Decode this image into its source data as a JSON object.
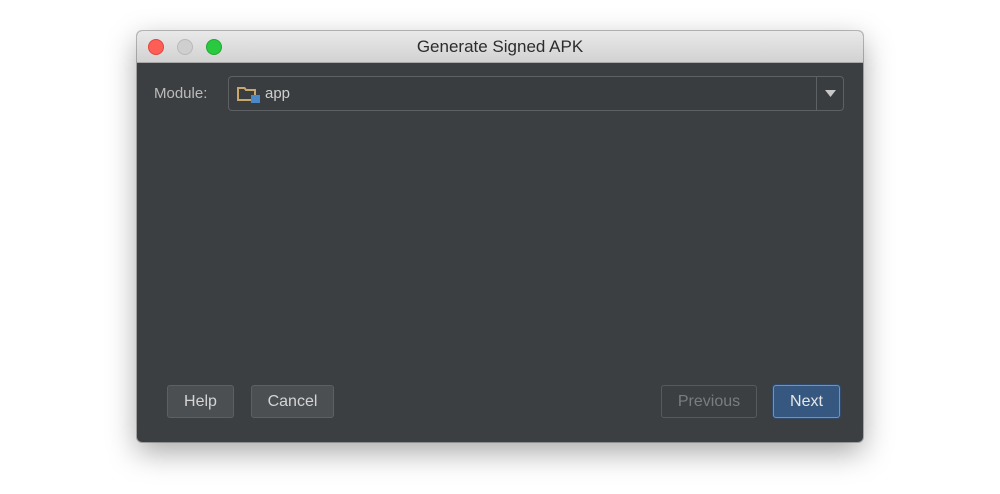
{
  "window": {
    "title": "Generate Signed APK"
  },
  "form": {
    "module_label": "Module:",
    "module_value": "app"
  },
  "buttons": {
    "help": "Help",
    "cancel": "Cancel",
    "previous": "Previous",
    "next": "Next"
  },
  "colors": {
    "window_background": "#3c3f41",
    "titlebar": "#dcdcdc",
    "accent_button": "#365880",
    "close_button": "#fd5f57",
    "zoom_button": "#29c940",
    "folder_icon": "#c9a66b",
    "module_badge": "#4a88c7"
  },
  "icons": {
    "module": "folder-module-icon",
    "dropdown": "chevron-down-icon"
  }
}
